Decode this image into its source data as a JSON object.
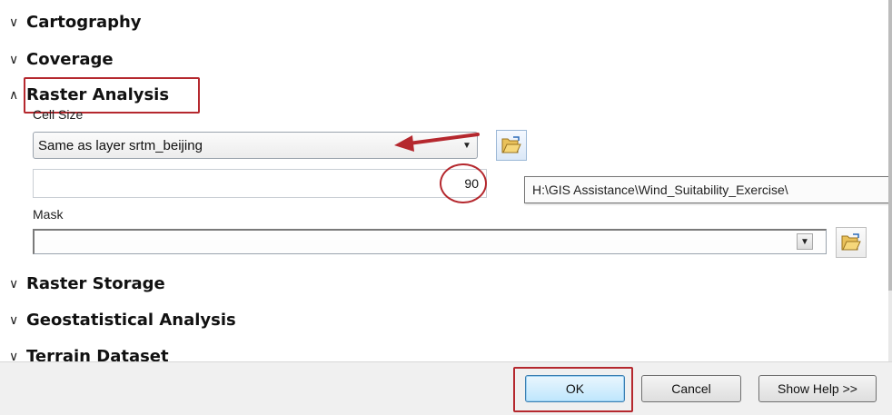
{
  "sections": {
    "cartography": "Cartography",
    "coverage": "Coverage",
    "raster_analysis": "Raster Analysis",
    "raster_storage": "Raster Storage",
    "geostatistical_analysis": "Geostatistical Analysis",
    "terrain_dataset": "Terrain Dataset"
  },
  "icons": {
    "collapsed": "chevron-double-down-icon",
    "expanded": "chevron-double-up-icon",
    "folder": "open-folder-icon"
  },
  "raster_analysis": {
    "cell_size_label": "Cell Size",
    "cell_size_value": "Same as layer srtm_beijing",
    "cell_size_number": "90",
    "tooltip_path": "H:\\GIS Assistance\\Wind_Suitability_Exercise\\",
    "mask_label": "Mask",
    "mask_value": ""
  },
  "buttons": {
    "ok": "OK",
    "cancel": "Cancel",
    "show_help": "Show Help >>"
  },
  "colors": {
    "annotation": "#b5282e",
    "button_bar": "#f0f0f0"
  }
}
